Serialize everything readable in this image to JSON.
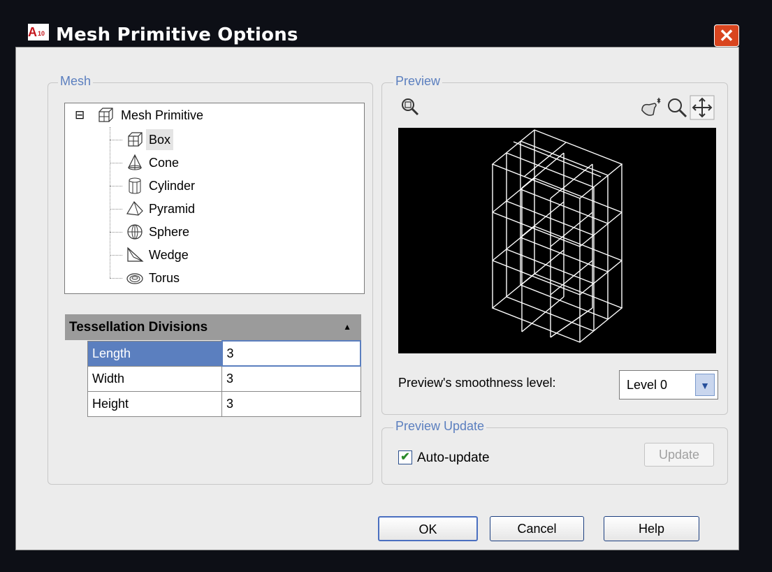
{
  "window": {
    "title": "Mesh Primitive Options",
    "app_icon_text": "A",
    "app_icon_sub": "10",
    "close_glyph": "✕"
  },
  "mesh_group": {
    "label": "Mesh",
    "tree": {
      "root": {
        "label": "Mesh Primitive",
        "expander": "⊟",
        "icon": "box-icon"
      },
      "items": [
        {
          "label": "Box",
          "icon": "box-icon",
          "selected": true
        },
        {
          "label": "Cone",
          "icon": "cone-icon"
        },
        {
          "label": "Cylinder",
          "icon": "cylinder-icon"
        },
        {
          "label": "Pyramid",
          "icon": "pyramid-icon"
        },
        {
          "label": "Sphere",
          "icon": "sphere-icon"
        },
        {
          "label": "Wedge",
          "icon": "wedge-icon"
        },
        {
          "label": "Torus",
          "icon": "torus-icon"
        }
      ]
    },
    "tessellation": {
      "header": "Tessellation Divisions",
      "collapse_glyph": "▲",
      "rows": [
        {
          "name": "Length",
          "value": "3"
        },
        {
          "name": "Width",
          "value": "3"
        },
        {
          "name": "Height",
          "value": "3"
        }
      ]
    }
  },
  "preview_group": {
    "label": "Preview",
    "smoothness_label": "Preview's smoothness level:",
    "smoothness_value": "Level 0",
    "dropdown_glyph": "▼"
  },
  "preview_update_group": {
    "label": "Preview Update",
    "auto_update_label": "Auto-update",
    "auto_update_checked": true,
    "check_glyph": "✔",
    "update_button": "Update"
  },
  "buttons": {
    "ok": "OK",
    "cancel": "Cancel",
    "help": "Help"
  }
}
